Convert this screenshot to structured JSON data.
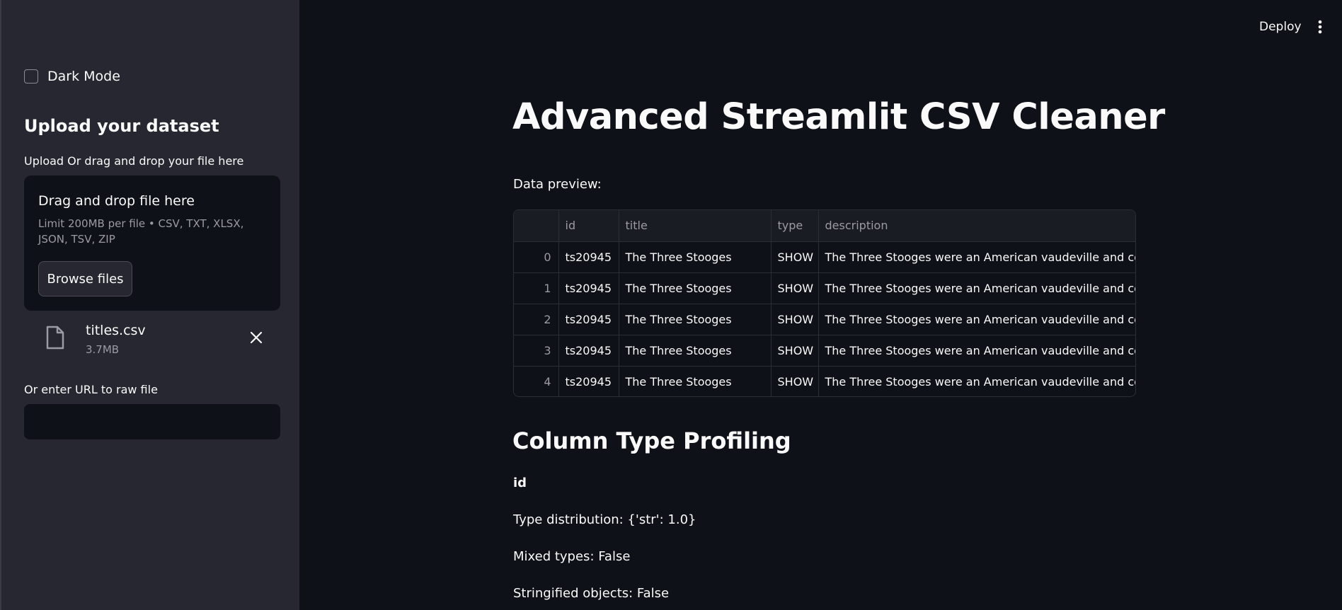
{
  "sidebar": {
    "dark_mode_label": "Dark Mode",
    "upload_heading": "Upload your dataset",
    "upload_label": "Upload Or drag and drop your file here",
    "dropzone": {
      "title": "Drag and drop file here",
      "limit": "Limit 200MB per file • CSV, TXT, XLSX, JSON, TSV, ZIP",
      "browse_label": "Browse files"
    },
    "file": {
      "name": "titles.csv",
      "size": "3.7MB",
      "icon": "file-icon"
    },
    "url_label": "Or enter URL to raw file",
    "url_value": ""
  },
  "header": {
    "deploy_label": "Deploy",
    "menu_icon": "vertical-ellipsis-icon"
  },
  "main": {
    "title": "Advanced Streamlit CSV Cleaner",
    "preview_label": "Data preview:",
    "table": {
      "columns": [
        "",
        "id",
        "title",
        "type",
        "description"
      ],
      "rows": [
        [
          "0",
          "ts20945",
          "The Three Stooges",
          "SHOW",
          "The Three Stooges were an American vaudeville and comedy"
        ],
        [
          "1",
          "ts20945",
          "The Three Stooges",
          "SHOW",
          "The Three Stooges were an American vaudeville and comedy"
        ],
        [
          "2",
          "ts20945",
          "The Three Stooges",
          "SHOW",
          "The Three Stooges were an American vaudeville and comedy"
        ],
        [
          "3",
          "ts20945",
          "The Three Stooges",
          "SHOW",
          "The Three Stooges were an American vaudeville and comedy"
        ],
        [
          "4",
          "ts20945",
          "The Three Stooges",
          "SHOW",
          "The Three Stooges were an American vaudeville and comedy"
        ]
      ]
    },
    "profiling": {
      "heading": "Column Type Profiling",
      "column_name": "id",
      "type_distribution": "Type distribution: {'str': 1.0}",
      "mixed_types": "Mixed types: False",
      "stringified_objects": "Stringified objects: False"
    }
  }
}
